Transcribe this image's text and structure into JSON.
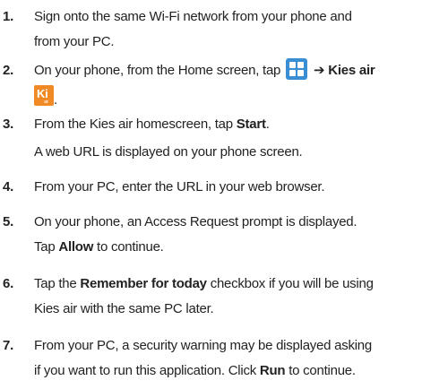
{
  "steps": [
    {
      "num": "1.",
      "line1": "Sign onto the same Wi-Fi network from your phone and",
      "line2": "from your PC."
    },
    {
      "num": "2.",
      "pre": "On your phone, from the Home screen, tap",
      "arrow": "➔",
      "bold": "Kies air",
      "end": "."
    },
    {
      "num": "3.",
      "pre": "From the Kies air homescreen, tap",
      "bold": "Start",
      "end": "."
    },
    {
      "note": "A web URL is displayed on your phone screen."
    },
    {
      "num": "4.",
      "line1": "From your PC, enter the URL in your web browser."
    },
    {
      "num": "5.",
      "line1": "On your phone, an Access Request prompt is displayed.",
      "pre2": "Tap",
      "bold2": "Allow",
      "end2": "to continue."
    },
    {
      "num": "6.",
      "pre": "Tap the",
      "bold": "Remember for today",
      "post": "checkbox if you will be using",
      "line2": "Kies air with the same PC later."
    },
    {
      "num": "7.",
      "line1": "From your PC, a security warning may be displayed asking",
      "pre2": "if you want to run this application. Click",
      "bold2": "Run",
      "end2": "to continue."
    }
  ],
  "icons": {
    "apps": "apps-grid-icon",
    "kies": "kies-air-icon",
    "kies_text": "Ki",
    "kies_sub": "air",
    "apps_color": "#3a8fd4",
    "kies_color": "#f08a24"
  }
}
